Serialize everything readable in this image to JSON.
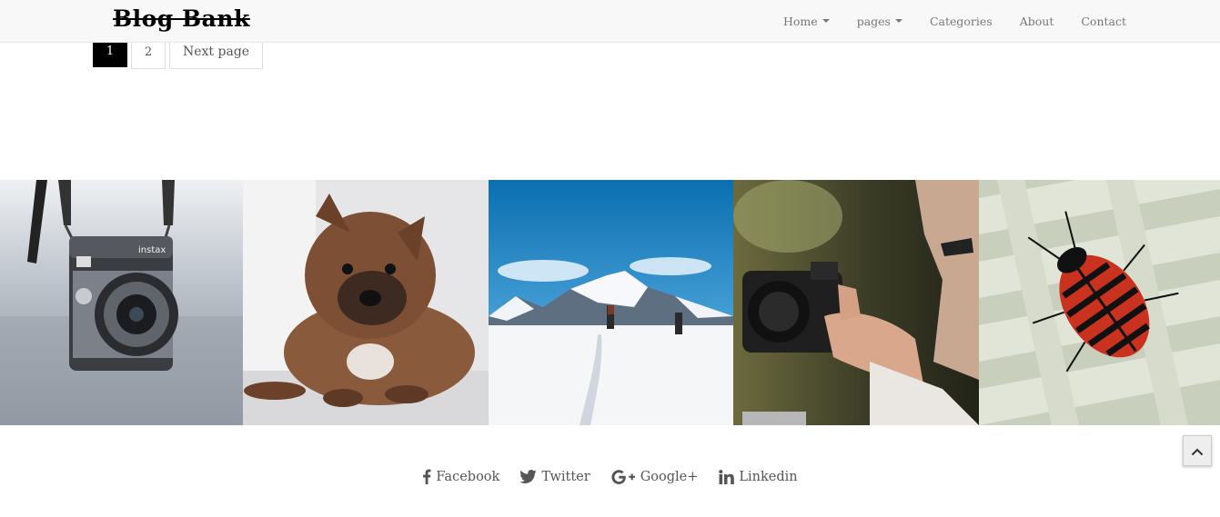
{
  "brand": {
    "name": "Blog Bank"
  },
  "nav": {
    "items": [
      {
        "label": "Home",
        "dropdown": true
      },
      {
        "label": "pages",
        "dropdown": true
      },
      {
        "label": "Categories",
        "dropdown": false
      },
      {
        "label": "About",
        "dropdown": false
      },
      {
        "label": "Contact",
        "dropdown": false
      }
    ]
  },
  "pagination": {
    "current": "1",
    "next_num": "2",
    "next_label": "Next page"
  },
  "gallery": {
    "images": [
      {
        "subject": "instant camera",
        "icon": "camera-photo"
      },
      {
        "subject": "puppy",
        "icon": "puppy-photo"
      },
      {
        "subject": "snowy mountain hikers",
        "icon": "mountain-photo"
      },
      {
        "subject": "photographer with camera",
        "icon": "photographer-photo"
      },
      {
        "subject": "red striped beetle",
        "icon": "beetle-photo"
      }
    ]
  },
  "social": {
    "facebook": {
      "label": "Facebook",
      "icon": "facebook-icon"
    },
    "twitter": {
      "label": "Twitter",
      "icon": "twitter-icon"
    },
    "googleplus": {
      "label": "Google+",
      "icon": "google-plus-icon"
    },
    "linkedin": {
      "label": "Linkedin",
      "icon": "linkedin-icon"
    }
  },
  "scroll_top": {
    "icon": "chevron-up-icon"
  },
  "colors": {
    "navbar_bg": "#f8f8f8",
    "active_page": "#000000",
    "text": "#555555"
  }
}
